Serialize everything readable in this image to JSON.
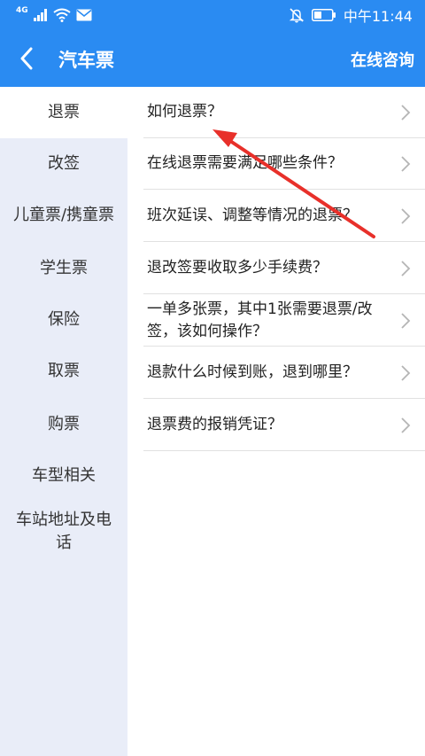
{
  "status_bar": {
    "network_type": "4G",
    "time": "中午11:44",
    "icons": [
      "signal-icon",
      "wifi-icon",
      "mail-icon",
      "mute-icon",
      "battery-icon"
    ]
  },
  "header": {
    "back_icon": "chevron-left-icon",
    "title": "汽车票",
    "consult_label": "在线咨询"
  },
  "sidebar": {
    "active_index": 0,
    "items": [
      {
        "label": "退票"
      },
      {
        "label": "改签"
      },
      {
        "label": "儿童票/携童票"
      },
      {
        "label": "学生票"
      },
      {
        "label": "保险"
      },
      {
        "label": "取票"
      },
      {
        "label": "购票"
      },
      {
        "label": "车型相关"
      },
      {
        "label": "车站地址及电话"
      }
    ]
  },
  "questions": [
    {
      "text": "如何退票？"
    },
    {
      "text": "在线退票需要满足哪些条件？"
    },
    {
      "text": "班次延误、调整等情况的退票？"
    },
    {
      "text": "退改签要收取多少手续费？"
    },
    {
      "text": "一单多张票，其中1张需要退票/改签，该如何操作？"
    },
    {
      "text": "退款什么时候到账，退到哪里？"
    },
    {
      "text": "退票费的报销凭证？"
    }
  ],
  "colors": {
    "primary": "#2a8bf2",
    "sidebar_bg": "#e9edf8",
    "annotation_arrow": "#e8302a"
  }
}
